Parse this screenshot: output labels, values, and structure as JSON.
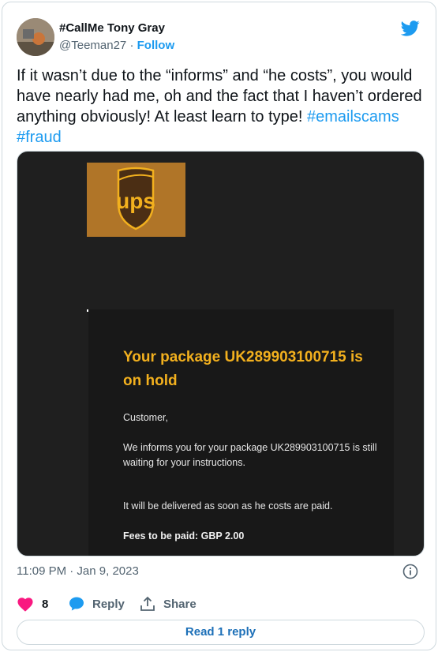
{
  "author": {
    "display_name": "#CallMe Tony Gray",
    "handle": "@Teeman27",
    "separator": "·",
    "follow_label": "Follow",
    "avatar_icon": "user-avatar-photo"
  },
  "tweet": {
    "text_part1": "If it wasn’t due to the “informs” and “he costs”, you would have nearly had me, oh and the fact that I haven’t ordered anything obviously! At least learn to type! ",
    "hashtag1": "#emailscams",
    "hashtag2": "#fraud"
  },
  "media": {
    "logo_text": "ups",
    "email": {
      "title": "Your package UK289903100715 is on hold",
      "greeting": "Customer,",
      "body1": "We informs you for your package UK289903100715 is still waiting for your instructions.",
      "body2": "It will be delivered as soon as he costs are paid.",
      "fees": "Fees to be paid: GBP 2.00"
    }
  },
  "meta": {
    "timestamp": "11:09 PM · Jan 9, 2023"
  },
  "actions": {
    "like_count": "8",
    "reply_label": "Reply",
    "share_label": "Share"
  },
  "replies": {
    "read_label": "Read 1 reply"
  },
  "colors": {
    "accent": "#1d9bf0",
    "like": "#f91880",
    "ups_gold": "#f2b01e",
    "ups_brown": "#4b2e14"
  }
}
